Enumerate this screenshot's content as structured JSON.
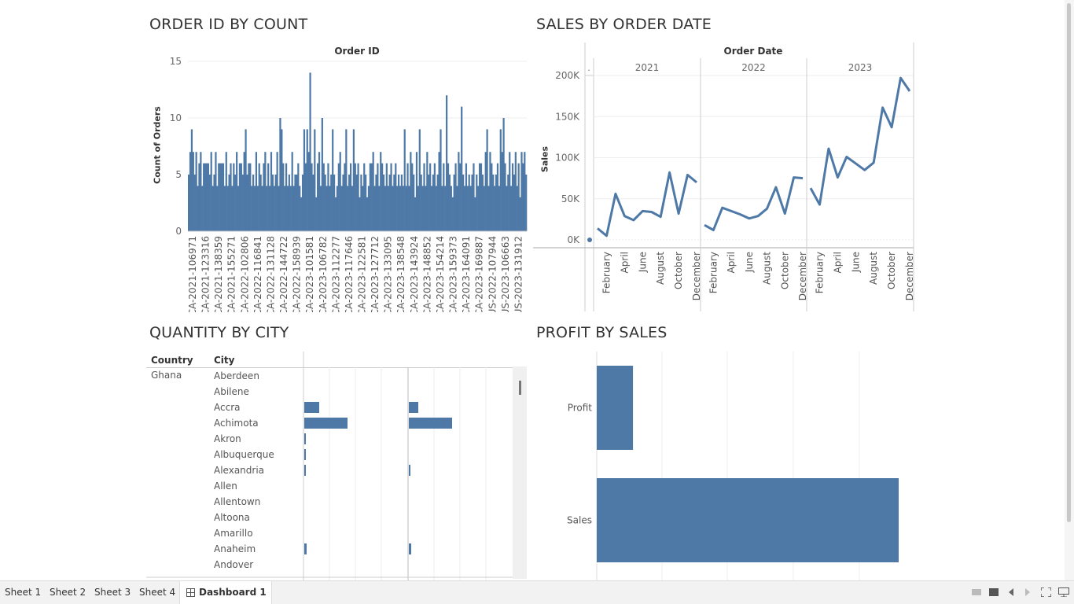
{
  "dashboard": {
    "panels": {
      "order_count": {
        "title": "ORDER ID BY COUNT",
        "header": "Order ID",
        "ylabel": "Count of Orders",
        "yticks": [
          "15",
          "10",
          "5",
          "0"
        ]
      },
      "sales_date": {
        "title": "SALES BY ORDER DATE",
        "header": "Order Date",
        "ylabel": "Sales",
        "dot_label": ".",
        "yticks": [
          "200K",
          "150K",
          "100K",
          "50K",
          "0K"
        ]
      },
      "qty_city": {
        "title": "QUANTITY BY CITY",
        "col_country": "Country",
        "col_city": "City"
      },
      "profit_sales": {
        "title": "PROFIT BY SALES"
      }
    }
  },
  "chart_data": [
    {
      "type": "bar",
      "title": "ORDER ID BY COUNT",
      "xlabel": "Order ID",
      "ylabel": "Count of Orders",
      "ylim": [
        0,
        15
      ],
      "tick_labels": [
        "CA-2021-106971",
        "CA-2021-123316",
        "CA-2021-138359",
        "CA-2021-155271",
        "CA-2022-102806",
        "CA-2022-116841",
        "CA-2022-131128",
        "CA-2022-144722",
        "CA-2022-158939",
        "CA-2023-101581",
        "CA-2023-106782",
        "CA-2023-112277",
        "CA-2023-117646",
        "CA-2023-122581",
        "CA-2023-127712",
        "CA-2023-133095",
        "CA-2023-138548",
        "CA-2023-143924",
        "CA-2023-148852",
        "CA-2023-154214",
        "CA-2023-159373",
        "CA-2023-164091",
        "CA-2023-169887",
        "US-2022-107944",
        "US-2023-106663",
        "US-2023-131912"
      ],
      "values": [
        5,
        7,
        9,
        7,
        5,
        7,
        4,
        6,
        7,
        4,
        6,
        6,
        6,
        6,
        5,
        7,
        4,
        5,
        7,
        4,
        6,
        6,
        6,
        6,
        4,
        7,
        4,
        5,
        6,
        4,
        6,
        5,
        7,
        4,
        6,
        6,
        5,
        7,
        9,
        5,
        6,
        6,
        4,
        5,
        4,
        7,
        4,
        6,
        5,
        4,
        6,
        7,
        4,
        6,
        4,
        7,
        5,
        4,
        5,
        7,
        4,
        10,
        9,
        6,
        4,
        6,
        4,
        5,
        4,
        7,
        4,
        5,
        5,
        6,
        4,
        3,
        5,
        9,
        6,
        9,
        7,
        14,
        6,
        5,
        9,
        3,
        6,
        7,
        4,
        10,
        6,
        5,
        4,
        6,
        4,
        5,
        9,
        5,
        3,
        4,
        6,
        7,
        4,
        5,
        6,
        9,
        4,
        5,
        6,
        4,
        9,
        6,
        5,
        6,
        3,
        5,
        4,
        6,
        5,
        3,
        4,
        6,
        6,
        7,
        4,
        5,
        6,
        4,
        7,
        6,
        5,
        4,
        6,
        4,
        5,
        6,
        4,
        5,
        6,
        4,
        5,
        4,
        5,
        4,
        9,
        4,
        6,
        4,
        7,
        6,
        5,
        3,
        7,
        4,
        9,
        5,
        4,
        6,
        4,
        7,
        5,
        6,
        4,
        5,
        6,
        4,
        5,
        7,
        9,
        4,
        6,
        4,
        12,
        6,
        5,
        4,
        3,
        5,
        6,
        4,
        7,
        6,
        11,
        5,
        4,
        6,
        4,
        5,
        4,
        5,
        6,
        3,
        5,
        4,
        6,
        6,
        5,
        4,
        7,
        9,
        4,
        7,
        6,
        5,
        4,
        5,
        6,
        4,
        9,
        7,
        10,
        6,
        4,
        5,
        7,
        4,
        6,
        5,
        7,
        4,
        6,
        3,
        7,
        6,
        7,
        5
      ],
      "count": 220
    },
    {
      "type": "line",
      "title": "SALES BY ORDER DATE",
      "xlabel": "Order Date",
      "ylabel": "Sales",
      "ylim": [
        0,
        200000
      ],
      "year_headers": [
        "2021",
        "2022",
        "2023"
      ],
      "month_labels": [
        "February",
        "April",
        "June",
        "August",
        "October",
        "December"
      ],
      "series": [
        {
          "year": "2021",
          "values": [
            14000,
            5000,
            56000,
            29000,
            24000,
            35000,
            34000,
            28000,
            82000,
            32000,
            79000,
            70000
          ]
        },
        {
          "year": "2022",
          "values": [
            18000,
            12000,
            39000,
            35000,
            31000,
            26000,
            29000,
            38000,
            64000,
            32000,
            76000,
            75000
          ]
        },
        {
          "year": "2023",
          "values": [
            63000,
            43000,
            111000,
            76000,
            101000,
            93000,
            85000,
            94000,
            161000,
            137000,
            197000,
            181000
          ]
        }
      ],
      "extra_point": {
        "label": ".",
        "value": 0
      }
    },
    {
      "type": "bar",
      "title": "QUANTITY BY CITY",
      "columns": [
        "Country",
        "City"
      ],
      "rows": [
        {
          "country": "Ghana",
          "city": "Aberdeen",
          "a": 0,
          "b": 0
        },
        {
          "country": "",
          "city": "Abilene",
          "a": 0,
          "b": 0
        },
        {
          "country": "",
          "city": "Accra",
          "a": 19,
          "b": 12
        },
        {
          "country": "",
          "city": "Achimota",
          "a": 55,
          "b": 55
        },
        {
          "country": "",
          "city": "Akron",
          "a": 1,
          "b": 0
        },
        {
          "country": "",
          "city": "Albuquerque",
          "a": 1,
          "b": 0
        },
        {
          "country": "",
          "city": "Alexandria",
          "a": 2,
          "b": 2
        },
        {
          "country": "",
          "city": "Allen",
          "a": 0,
          "b": 0
        },
        {
          "country": "",
          "city": "Allentown",
          "a": 0,
          "b": 0
        },
        {
          "country": "",
          "city": "Altoona",
          "a": 0,
          "b": 0
        },
        {
          "country": "",
          "city": "Amarillo",
          "a": 0,
          "b": 0
        },
        {
          "country": "",
          "city": "Anaheim",
          "a": 3,
          "b": 3
        },
        {
          "country": "",
          "city": "Andover",
          "a": 0,
          "b": 0
        }
      ]
    },
    {
      "type": "bar",
      "title": "PROFIT BY SALES",
      "categories": [
        "Profit",
        "Sales"
      ],
      "values": [
        0.12,
        1.0
      ]
    }
  ],
  "tabs": [
    "Sheet 1",
    "Sheet 2",
    "Sheet 3",
    "Sheet 4",
    "Dashboard 1"
  ],
  "tab_icons": {
    "dashboard": "grid-icon"
  },
  "colors": {
    "bar": "#4e79a7",
    "grid": "#eeeeee",
    "axis": "#c8c8c8"
  }
}
